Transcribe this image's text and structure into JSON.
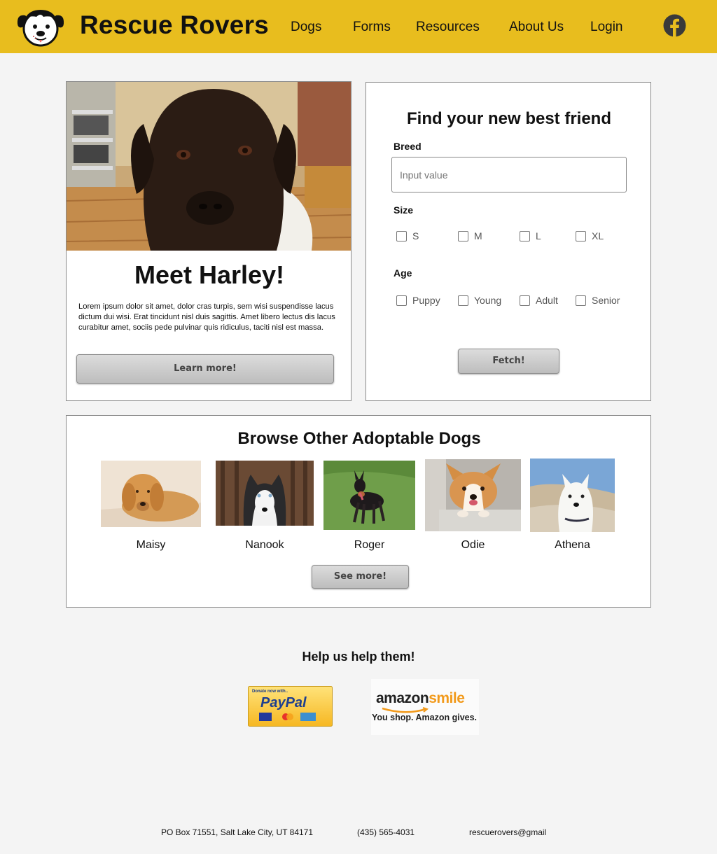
{
  "header": {
    "brand": "Rescue Rovers",
    "logo_icon": "dog-face-icon",
    "nav": [
      "Dogs",
      "Forms",
      "Resources",
      "About Us",
      "Login"
    ],
    "social_icon": "facebook-icon"
  },
  "feature": {
    "title": "Meet Harley!",
    "text": "Lorem ipsum dolor sit amet, dolor cras turpis, sem wisi suspendisse lacus dictum dui wisi. Erat tincidunt nisl duis sagittis. Amet libero lectus dis lacus curabitur amet, sociis pede pulvinar quis ridiculus, taciti nisl est massa.",
    "button": "Learn more!"
  },
  "search": {
    "title": "Find your new best friend",
    "breed_label": "Breed",
    "breed_placeholder": "Input value",
    "size_label": "Size",
    "sizes": [
      "S",
      "M",
      "L",
      "XL"
    ],
    "age_label": "Age",
    "ages": [
      "Puppy",
      "Young",
      "Adult",
      "Senior"
    ],
    "button": "Fetch!"
  },
  "browse": {
    "title": "Browse Other Adoptable Dogs",
    "dogs": [
      "Maisy",
      "Nanook",
      "Roger",
      "Odie",
      "Athena"
    ],
    "button": "See more!"
  },
  "help": {
    "title": "Help us help them!",
    "paypal_small": "Donate now with..",
    "paypal_brand": "PayPal",
    "amazon_brand_a": "amazon",
    "amazon_brand_b": "smile",
    "amazon_tagline": "You shop. Amazon gives."
  },
  "footer": {
    "address": "PO Box 71551, Salt Lake City, UT 84171",
    "phone": "(435) 565-4031",
    "email": "rescuerovers@gmail"
  },
  "colors": {
    "header": "#e8bd1e",
    "background": "#f4f4f4"
  }
}
